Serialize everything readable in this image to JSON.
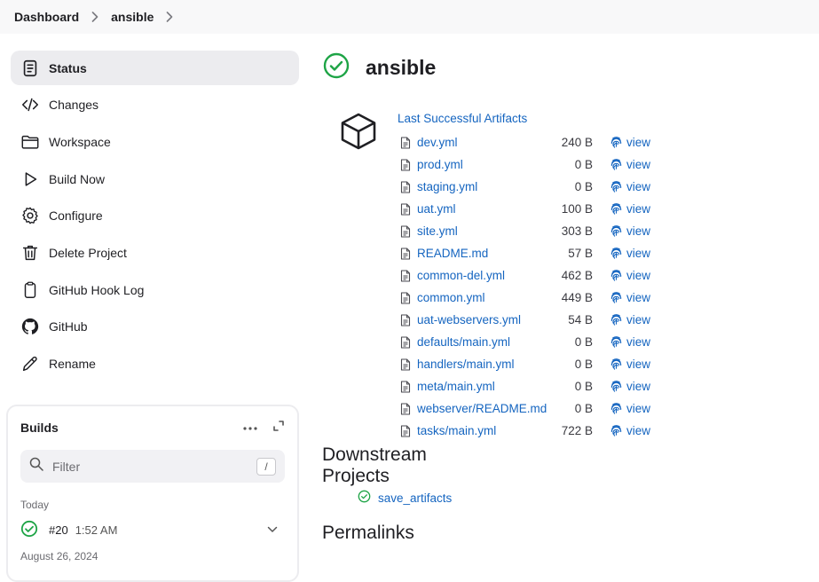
{
  "breadcrumb": {
    "items": [
      "Dashboard",
      "ansible"
    ]
  },
  "sidebar": {
    "items": [
      {
        "label": "Status",
        "icon": "document-icon"
      },
      {
        "label": "Changes",
        "icon": "code-icon"
      },
      {
        "label": "Workspace",
        "icon": "folder-icon"
      },
      {
        "label": "Build Now",
        "icon": "play-icon"
      },
      {
        "label": "Configure",
        "icon": "gear-icon"
      },
      {
        "label": "Delete Project",
        "icon": "trash-icon"
      },
      {
        "label": "GitHub Hook Log",
        "icon": "clipboard-icon"
      },
      {
        "label": "GitHub",
        "icon": "github-icon"
      },
      {
        "label": "Rename",
        "icon": "pencil-icon"
      }
    ]
  },
  "builds": {
    "title": "Builds",
    "filter_placeholder": "Filter",
    "filter_shortcut": "/",
    "today_label": "Today",
    "entries": [
      {
        "number": "#20",
        "time": "1:52 AM",
        "status": "success"
      }
    ],
    "next_date_label": "August 26, 2024"
  },
  "job": {
    "title": "ansible",
    "status": "success"
  },
  "artifacts": {
    "title": "Last Successful Artifacts",
    "view_label": "view",
    "files": [
      {
        "name": "dev.yml",
        "size": "240 B"
      },
      {
        "name": "prod.yml",
        "size": "0 B"
      },
      {
        "name": "staging.yml",
        "size": "0 B"
      },
      {
        "name": "uat.yml",
        "size": "100 B"
      },
      {
        "name": "site.yml",
        "size": "303 B"
      },
      {
        "name": "README.md",
        "size": "57 B"
      },
      {
        "name": "common-del.yml",
        "size": "462 B"
      },
      {
        "name": "common.yml",
        "size": "449 B"
      },
      {
        "name": "uat-webservers.yml",
        "size": "54 B"
      },
      {
        "name": "defaults/main.yml",
        "size": "0 B"
      },
      {
        "name": "handlers/main.yml",
        "size": "0 B"
      },
      {
        "name": "meta/main.yml",
        "size": "0 B"
      },
      {
        "name": "webserver/README.md",
        "size": "0 B"
      },
      {
        "name": "tasks/main.yml",
        "size": "722 B"
      }
    ]
  },
  "downstream": {
    "title": "Downstream Projects",
    "items": [
      {
        "label": "save_artifacts",
        "status": "success"
      }
    ]
  },
  "permalinks": {
    "title": "Permalinks"
  },
  "colors": {
    "link": "#1565c0",
    "success": "#1ea446",
    "active_bg": "#ececef"
  }
}
